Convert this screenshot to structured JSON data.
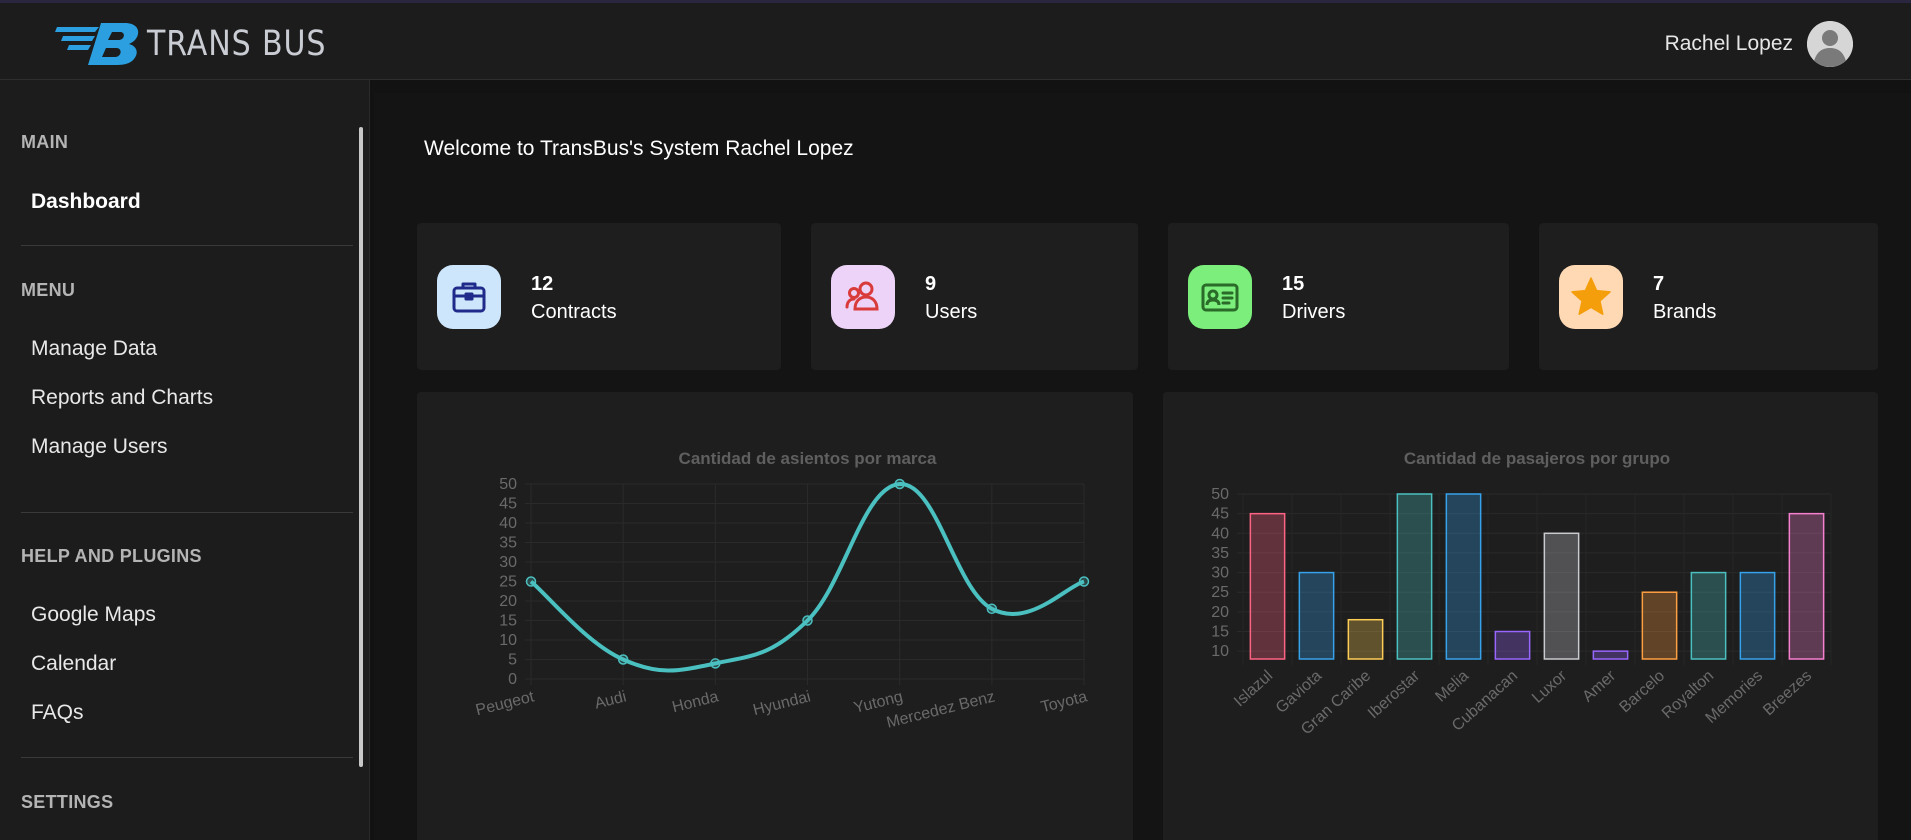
{
  "header": {
    "brand": "TRANS BUS",
    "user_name": "Rachel Lopez"
  },
  "sidebar": {
    "sections": [
      {
        "title": "MAIN",
        "items": [
          {
            "label": "Dashboard",
            "active": true
          }
        ]
      },
      {
        "title": "MENU",
        "items": [
          {
            "label": "Manage Data"
          },
          {
            "label": "Reports and Charts"
          },
          {
            "label": "Manage Users"
          }
        ]
      },
      {
        "title": "HELP AND PLUGINS",
        "items": [
          {
            "label": "Google Maps"
          },
          {
            "label": "Calendar"
          },
          {
            "label": "FAQs"
          }
        ]
      },
      {
        "title": "SETTINGS",
        "items": []
      }
    ]
  },
  "main": {
    "welcome": "Welcome to TransBus's System Rachel Lopez",
    "stats": [
      {
        "value": "12",
        "label": "Contracts",
        "icon": "briefcase-icon",
        "icon_bg": "#cde6fb",
        "icon_color": "#1f2a8a"
      },
      {
        "value": "9",
        "label": "Users",
        "icon": "users-icon",
        "icon_bg": "#ecd3f7",
        "icon_color": "#d93a3a"
      },
      {
        "value": "15",
        "label": "Drivers",
        "icon": "id-card-icon",
        "icon_bg": "#7bee7b",
        "icon_color": "#2a6b2a"
      },
      {
        "value": "7",
        "label": "Brands",
        "icon": "star-icon",
        "icon_bg": "#ffd9b3",
        "icon_color": "#f59e0b"
      }
    ]
  },
  "chart_data": [
    {
      "type": "line",
      "title": "Cantidad de asientos por marca",
      "categories": [
        "Peugeot",
        "Audi",
        "Honda",
        "Hyundai",
        "Yutong",
        "Mercedez Benz",
        "Toyota"
      ],
      "values": [
        25,
        5,
        4,
        15,
        50,
        18,
        25
      ],
      "ylim": [
        0,
        50
      ],
      "yticks": [
        0,
        5,
        10,
        15,
        20,
        25,
        30,
        35,
        40,
        45,
        50
      ],
      "color": "#4bc0c0",
      "grid": true
    },
    {
      "type": "bar",
      "title": "Cantidad de pasajeros por grupo",
      "categories": [
        "Islazul",
        "Gaviota",
        "Gran Caribe",
        "Iberostar",
        "Melia",
        "Cubanacan",
        "Luxor",
        "Amer",
        "Barcelo",
        "Royalton",
        "Memories",
        "Breezes"
      ],
      "values": [
        45,
        30,
        18,
        50,
        50,
        15,
        40,
        10,
        25,
        30,
        30,
        45
      ],
      "ylim": [
        8,
        50
      ],
      "yticks": [
        10,
        15,
        20,
        25,
        30,
        35,
        40,
        45,
        50
      ],
      "colors": [
        "#ff6384",
        "#36a2eb",
        "#ffce56",
        "#4bc0c0",
        "#36a2eb",
        "#9966ff",
        "#c9cbcf",
        "#9966ff",
        "#ff9f40",
        "#4bc0c0",
        "#36a2eb",
        "#f77fd0"
      ],
      "grid": true
    }
  ]
}
